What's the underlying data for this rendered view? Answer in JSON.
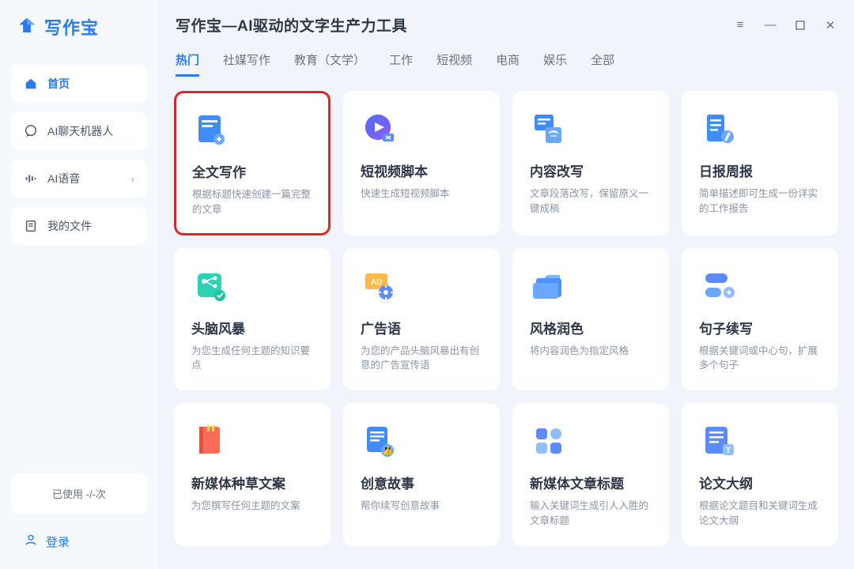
{
  "logo": {
    "text": "写作宝"
  },
  "sidebar": {
    "items": [
      {
        "label": "首页",
        "active": true
      },
      {
        "label": "AI聊天机器人",
        "active": false
      },
      {
        "label": "AI语音",
        "active": false,
        "chevron": true
      },
      {
        "label": "我的文件",
        "active": false
      }
    ]
  },
  "usage_text": "已使用 -/-次",
  "login_text": "登录",
  "app_title": "写作宝—AI驱动的文字生产力工具",
  "tabs": [
    "热门",
    "社媒写作",
    "教育（文学）",
    "工作",
    "短视频",
    "电商",
    "娱乐",
    "全部"
  ],
  "active_tab": 0,
  "cards": [
    {
      "title": "全文写作",
      "desc": "根据标题快速创建一篇完整的文章",
      "highlight": true
    },
    {
      "title": "短视频脚本",
      "desc": "快速生成短视频脚本"
    },
    {
      "title": "内容改写",
      "desc": "文章段落改写，保留原义一键成稿"
    },
    {
      "title": "日报周报",
      "desc": "简单描述即可生成一份详实的工作报告"
    },
    {
      "title": "头脑风暴",
      "desc": "为您生成任何主题的知识要点"
    },
    {
      "title": "广告语",
      "desc": "为您的产品头脑风暴出有创意的广告宣传语"
    },
    {
      "title": "风格润色",
      "desc": "将内容润色为指定风格"
    },
    {
      "title": "句子续写",
      "desc": "根据关键词或中心句，扩展多个句子"
    },
    {
      "title": "新媒体种草文案",
      "desc": "为您撰写任何主题的文案"
    },
    {
      "title": "创意故事",
      "desc": "帮你续写创意故事"
    },
    {
      "title": "新媒体文章标题",
      "desc": "输入关键词生成引人入胜的文章标题"
    },
    {
      "title": "论文大纲",
      "desc": "根据论文题目和关键词生成论文大纲"
    }
  ]
}
